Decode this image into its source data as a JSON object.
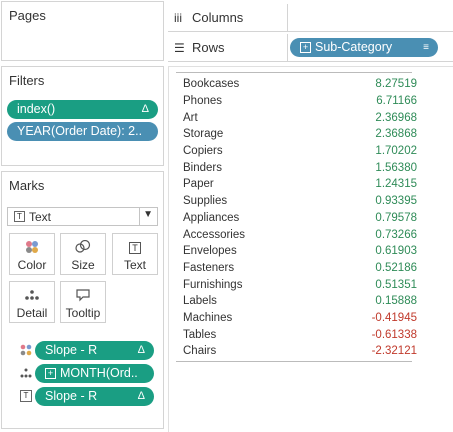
{
  "pages": {
    "title": "Pages"
  },
  "filters": {
    "title": "Filters",
    "items": [
      {
        "label": "index()",
        "marker": "Δ"
      },
      {
        "label": "YEAR(Order Date): 2.."
      }
    ]
  },
  "marks": {
    "title": "Marks",
    "mark_type": "Text",
    "buttons": [
      {
        "label": "Color",
        "icon": "color-dots-icon"
      },
      {
        "label": "Size",
        "icon": "size-icon"
      },
      {
        "label": "Text",
        "icon": "text-icon"
      },
      {
        "label": "Detail",
        "icon": "detail-icon"
      },
      {
        "label": "Tooltip",
        "icon": "tooltip-icon"
      }
    ],
    "fields": [
      {
        "label": "Slope - R",
        "marker": "Δ",
        "role": "color"
      },
      {
        "label": "MONTH(Ord..",
        "role": "detail"
      },
      {
        "label": "Slope - R",
        "marker": "Δ",
        "role": "text"
      }
    ]
  },
  "shelves": {
    "columns_label": "Columns",
    "rows_label": "Rows",
    "rows_pill": "Sub-Category"
  },
  "colors": {
    "positive": "#2e8b57",
    "negative": "#c0392b",
    "teal_pill": "#1a9e83",
    "blue_pill": "#4a8fb3"
  },
  "table": {
    "rows": [
      {
        "name": "Bookcases",
        "value": "8.27519"
      },
      {
        "name": "Phones",
        "value": "6.71166"
      },
      {
        "name": "Art",
        "value": "2.36968"
      },
      {
        "name": "Storage",
        "value": "2.36868"
      },
      {
        "name": "Copiers",
        "value": "1.70202"
      },
      {
        "name": "Binders",
        "value": "1.56380"
      },
      {
        "name": "Paper",
        "value": "1.24315"
      },
      {
        "name": "Supplies",
        "value": "0.93395"
      },
      {
        "name": "Appliances",
        "value": "0.79578"
      },
      {
        "name": "Accessories",
        "value": "0.73266"
      },
      {
        "name": "Envelopes",
        "value": "0.61903"
      },
      {
        "name": "Fasteners",
        "value": "0.52186"
      },
      {
        "name": "Furnishings",
        "value": "0.51351"
      },
      {
        "name": "Labels",
        "value": "0.15888"
      },
      {
        "name": "Machines",
        "value": "-0.41945"
      },
      {
        "name": "Tables",
        "value": "-0.61338"
      },
      {
        "name": "Chairs",
        "value": "-2.32121"
      }
    ]
  }
}
